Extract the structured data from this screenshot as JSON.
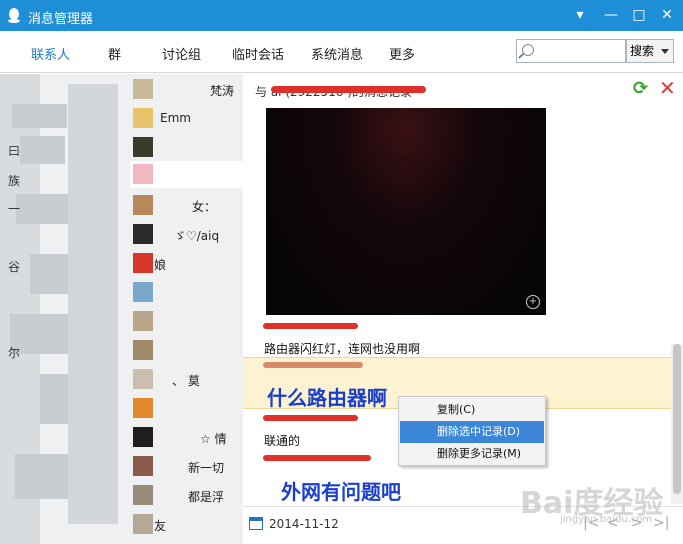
{
  "window": {
    "title": "消息管理器",
    "min": "▾",
    "minimize": "—",
    "maximize": "□",
    "close": "✕"
  },
  "tabs": [
    {
      "label": "联系人",
      "active": true
    },
    {
      "label": "群"
    },
    {
      "label": "讨论组"
    },
    {
      "label": "临时会话"
    },
    {
      "label": "系统消息"
    },
    {
      "label": "更多"
    }
  ],
  "search": {
    "placeholder": "",
    "button": "搜索"
  },
  "contacts": [
    {
      "name": "梵涛"
    },
    {
      "name": "Emm"
    },
    {
      "name": ""
    },
    {
      "name": ""
    },
    {
      "name": "女："
    },
    {
      "name": "ゞ♡/aiq"
    },
    {
      "name": "娘"
    },
    {
      "name": ""
    },
    {
      "name": ""
    },
    {
      "name": ""
    },
    {
      "name": "、 莫"
    },
    {
      "name": ""
    },
    {
      "name": "☆ 情"
    },
    {
      "name": "新一切"
    },
    {
      "name": "都是浮"
    },
    {
      "name": "友"
    }
  ],
  "left_glyphs": [
    "曰",
    "族",
    "一",
    "谷",
    "尔"
  ],
  "history": {
    "header": "与 ai (2922516 )的消息记录",
    "messages": [
      {
        "text": "路由器闪红灯，连网也没用啊"
      },
      {
        "text": "什么路由器啊"
      },
      {
        "text": "联通的"
      },
      {
        "text": "外网有问题吧"
      }
    ],
    "date": "2014-11-12"
  },
  "context_menu": [
    {
      "label": "复制(C)"
    },
    {
      "label": "删除选中记录(D)",
      "active": true
    },
    {
      "label": "删除更多记录(M)"
    }
  ],
  "pager": {
    "first": "|<",
    "prev": "<",
    "next": ">",
    "last": ">|"
  },
  "watermark": {
    "main": "Bai度经验",
    "sub": "jingyan.baidu.com"
  },
  "colors": {
    "titlebar": "#1e8fd6",
    "accent": "#1e7ac8",
    "highlight": "#fdf3d0",
    "menu_active": "#3b86d6",
    "big_text": "#1a3fd0"
  }
}
